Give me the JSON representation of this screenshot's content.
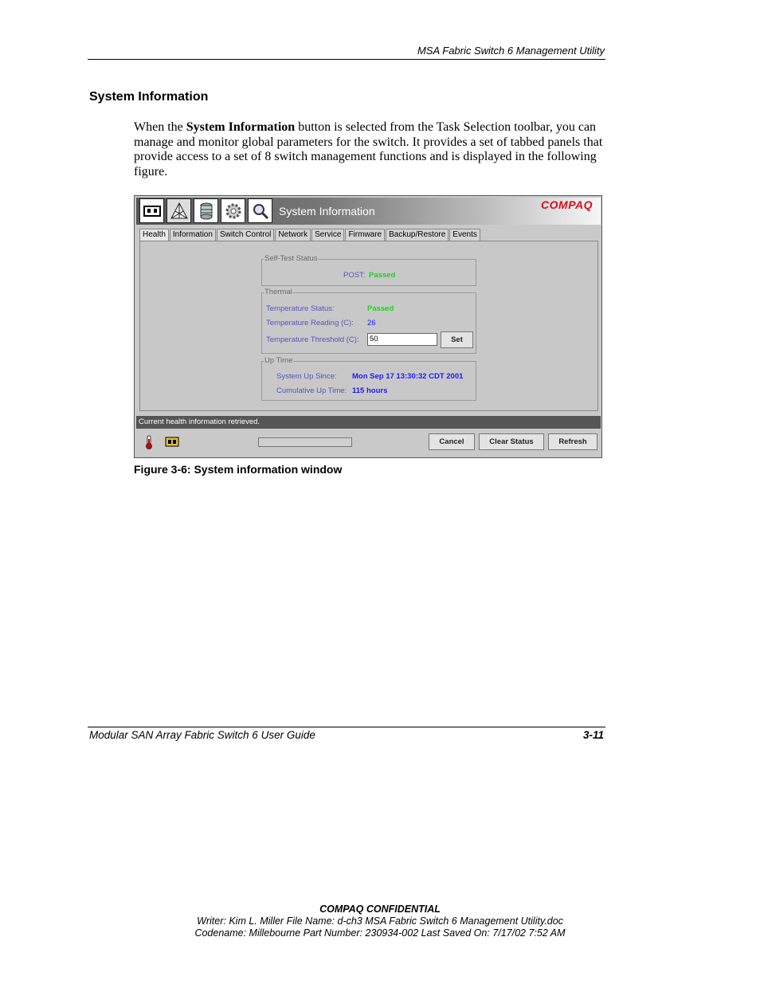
{
  "header": {
    "running_title": "MSA Fabric Switch 6 Management Utility"
  },
  "section": {
    "title": "System Information",
    "para_before_bold": "When the ",
    "para_bold": "System Information",
    "para_after_bold": " button is selected from the Task Selection toolbar, you can manage and monitor global parameters for the switch. It provides a set of tabbed panels that provide access to a set of 8 switch management functions and is displayed in the following figure."
  },
  "window": {
    "title": "System Information",
    "brand": "COMPAQ",
    "toolbar_icons": [
      "switch-icon",
      "fabric-icon",
      "database-icon",
      "gear-icon",
      "magnifier-icon"
    ],
    "tabs": [
      "Health",
      "Information",
      "Switch Control",
      "Network",
      "Service",
      "Firmware",
      "Backup/Restore",
      "Events"
    ],
    "active_tab": "Health",
    "self_test": {
      "legend": "Self-Test Status",
      "post_label": "POST:",
      "post_value": "Passed"
    },
    "thermal": {
      "legend": "Thermal",
      "status_label": "Temperature Status:",
      "status_value": "Passed",
      "reading_label": "Temperature Reading (C):",
      "reading_value": "26",
      "threshold_label": "Temperature Threshold (C):",
      "threshold_value": "50",
      "set_button": "Set"
    },
    "uptime": {
      "legend": "Up Time",
      "since_label": "System Up Since:",
      "since_value": "Mon Sep 17 13:30:32 CDT 2001",
      "cumulative_label": "Cumulative Up Time:",
      "cumulative_value": "115 hours"
    },
    "status_message": "Current health information retrieved.",
    "bottom_icons": [
      "thermometer-icon",
      "switch-status-icon"
    ],
    "buttons": {
      "cancel": "Cancel",
      "clear_status": "Clear Status",
      "refresh": "Refresh"
    }
  },
  "caption": "Figure 3-6:  System information window",
  "footer": {
    "guide_title": "Modular SAN Array Fabric Switch 6 User Guide",
    "page_number": "3-11",
    "confidential": "COMPAQ CONFIDENTIAL",
    "writer_line": "Writer: Kim L. Miller File Name: d-ch3 MSA Fabric Switch 6 Management Utility.doc",
    "codename_line": "Codename: Millebourne Part Number: 230934-002 Last Saved On: 7/17/02 7:52 AM"
  }
}
